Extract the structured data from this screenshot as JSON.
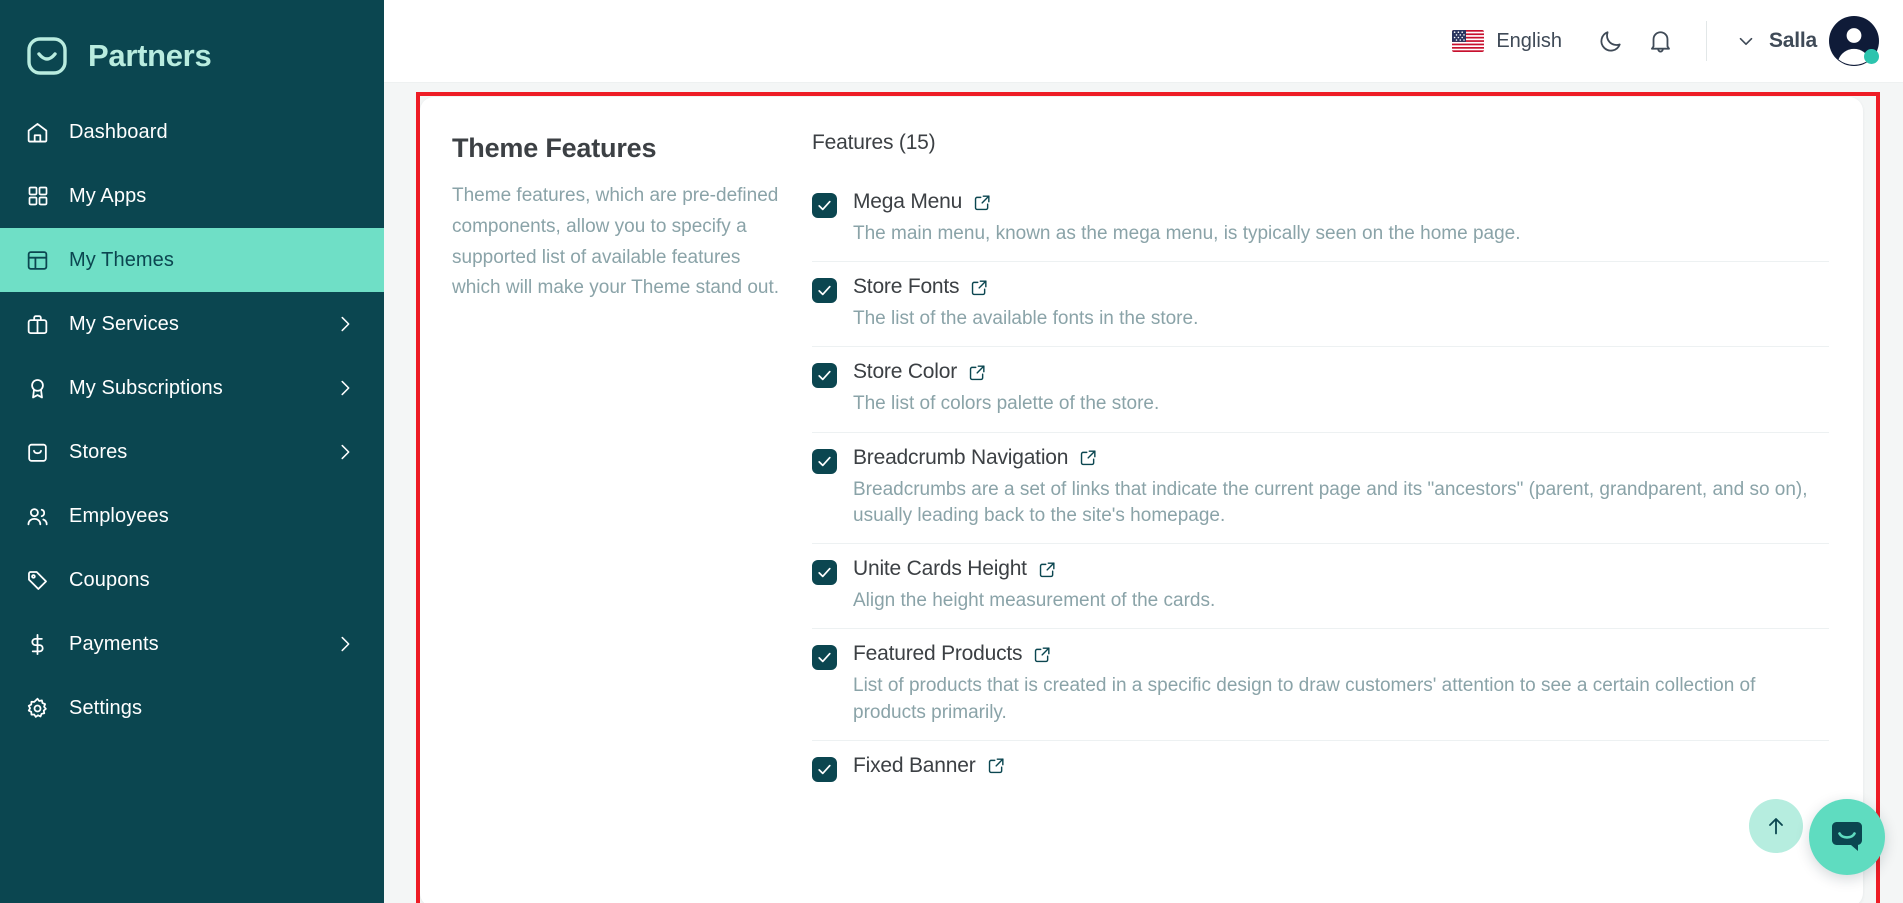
{
  "brand": {
    "name": "Partners",
    "logo_icon": "salla-smile-logo-icon"
  },
  "sidebar": {
    "items": [
      {
        "label": "Dashboard",
        "icon": "home-icon",
        "active": false,
        "has_chevron": false
      },
      {
        "label": "My Apps",
        "icon": "grid-apps-icon",
        "active": false,
        "has_chevron": false
      },
      {
        "label": "My Themes",
        "icon": "layout-theme-icon",
        "active": true,
        "has_chevron": false
      },
      {
        "label": "My Services",
        "icon": "briefcase-icon",
        "active": false,
        "has_chevron": true
      },
      {
        "label": "My Subscriptions",
        "icon": "award-badge-icon",
        "active": false,
        "has_chevron": true
      },
      {
        "label": "Stores",
        "icon": "shopping-bag-icon",
        "active": false,
        "has_chevron": true
      },
      {
        "label": "Employees",
        "icon": "users-icon",
        "active": false,
        "has_chevron": false
      },
      {
        "label": "Coupons",
        "icon": "tag-icon",
        "active": false,
        "has_chevron": false
      },
      {
        "label": "Payments",
        "icon": "dollar-icon",
        "active": false,
        "has_chevron": true
      },
      {
        "label": "Settings",
        "icon": "gear-icon",
        "active": false,
        "has_chevron": false
      }
    ]
  },
  "topbar": {
    "language": "English",
    "flag_icon": "us-flag-icon",
    "dark_mode_icon": "moon-icon",
    "notifications_icon": "bell-icon",
    "user_name": "Salla",
    "user_chevron_icon": "chevron-down-icon",
    "avatar_icon": "user-avatar-icon"
  },
  "panel": {
    "title": "Theme Features",
    "description": "Theme features, which are pre-defined components, allow you to specify a supported list of available features which will make your Theme stand out.",
    "features_heading": "Features (15)",
    "features": [
      {
        "label": "Mega Menu",
        "description": "The main menu, known as the mega menu, is typically seen on the home page.",
        "checked": true
      },
      {
        "label": "Store Fonts",
        "description": "The list of the available fonts in the store.",
        "checked": true
      },
      {
        "label": "Store Color",
        "description": "The list of colors palette of the store.",
        "checked": true
      },
      {
        "label": "Breadcrumb Navigation",
        "description": "Breadcrumbs are a set of links that indicate the current page and its \"ancestors\" (parent, grandparent, and so on), usually leading back to the site's homepage.",
        "checked": true
      },
      {
        "label": "Unite Cards Height",
        "description": "Align the height measurement of the cards.",
        "checked": true
      },
      {
        "label": "Featured Products",
        "description": "List of products that is created in a specific design to draw customers' attention to see a certain collection of products primarily.",
        "checked": true
      },
      {
        "label": "Fixed Banner",
        "description": "",
        "checked": true
      }
    ]
  },
  "floating": {
    "scroll_top_icon": "arrow-up-icon",
    "chat_icon": "chat-bubble-icon"
  },
  "colors": {
    "sidebar_bg": "#0b4650",
    "active_item_bg": "#6fdfc6",
    "accent_mint": "#5fdcc0",
    "muted_text": "#8aa3a8",
    "annotation_red": "#ee1c25"
  }
}
